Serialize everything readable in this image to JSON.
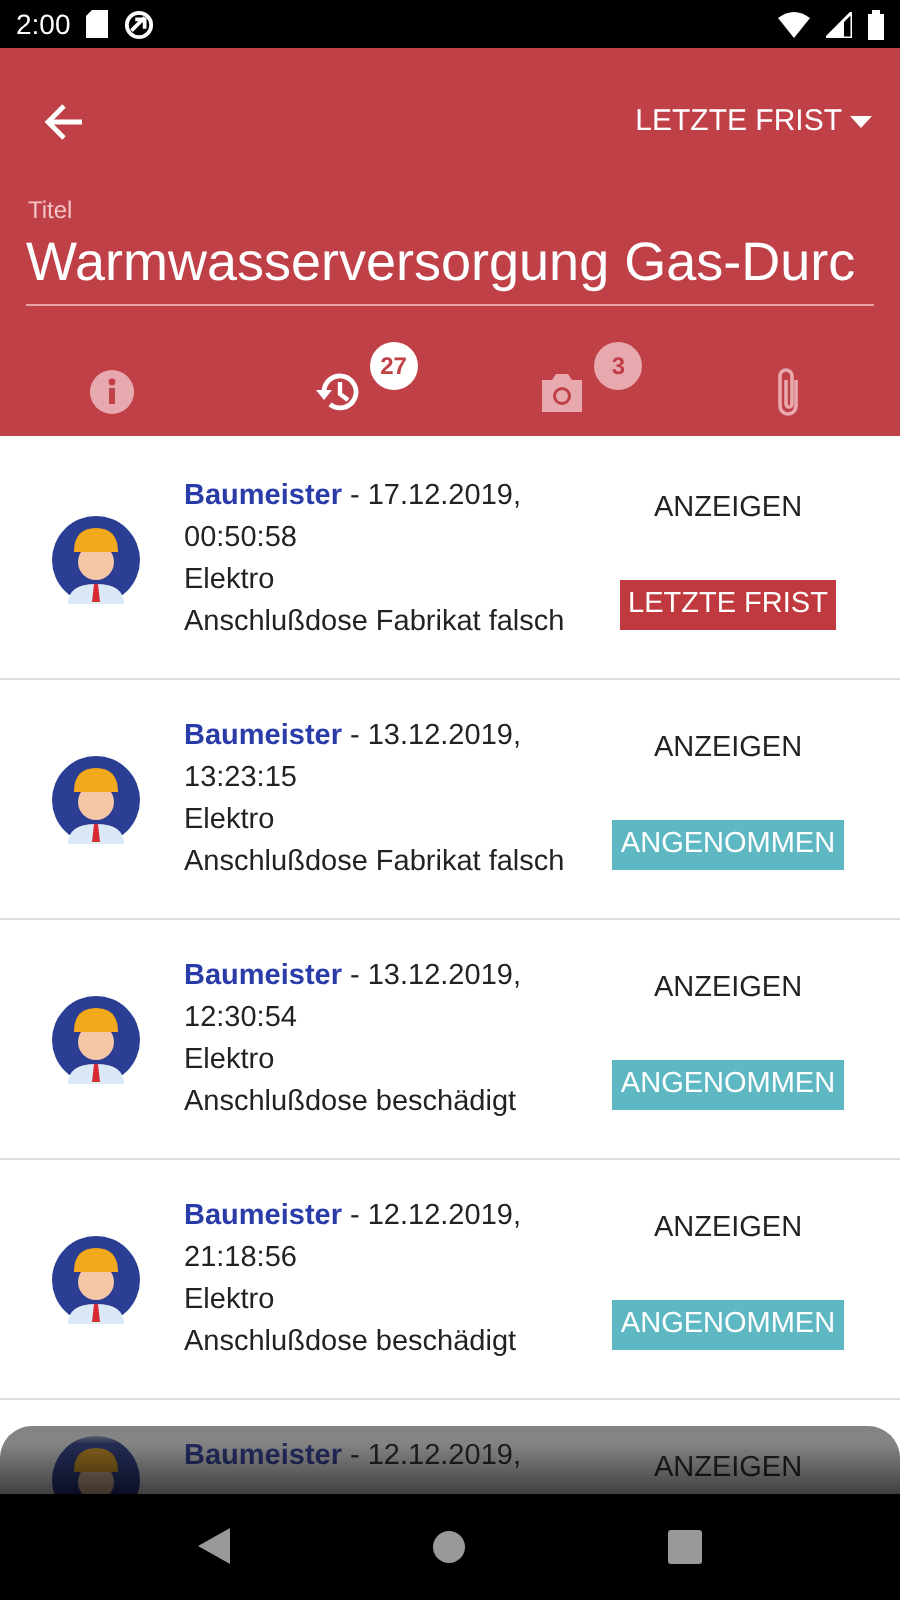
{
  "status_bar": {
    "time": "2:00"
  },
  "header": {
    "filter": "LETZTE FRIST",
    "title_label": "Titel",
    "title_value": "Warmwasserversorgung Gas-Durc"
  },
  "tabs": [
    {
      "kind": "info",
      "selected": false
    },
    {
      "kind": "history",
      "selected": true,
      "badge": "27"
    },
    {
      "kind": "camera",
      "selected": false,
      "badge": "3"
    },
    {
      "kind": "attachment",
      "selected": false
    }
  ],
  "entries": [
    {
      "heading": "**Baumeister** - 17.12.2019, 00:50:58",
      "category": "Elektro",
      "description": "Anschlußdose Fabrikat falsch",
      "action": "ANZEIGEN",
      "status": {
        "kind": "deadline",
        "label": "LETZTE FRIST"
      }
    },
    {
      "heading": "**Baumeister** - 13.12.2019, 13:23:15",
      "category": "Elektro",
      "description": "Anschlußdose Fabrikat falsch",
      "action": "ANZEIGEN",
      "status": {
        "kind": "accepted",
        "label": "ANGENOMMEN"
      }
    },
    {
      "heading": "**Baumeister** - 13.12.2019, 12:30:54",
      "category": "Elektro",
      "description": "Anschlußdose beschädigt",
      "action": "ANZEIGEN",
      "status": {
        "kind": "accepted",
        "label": "ANGENOMMEN"
      }
    },
    {
      "heading": "**Baumeister** - 12.12.2019, 21:18:56",
      "category": "Elektro",
      "description": "Anschlußdose beschädigt",
      "action": "ANZEIGEN",
      "status": {
        "kind": "accepted",
        "label": "ANGENOMMEN"
      }
    },
    {
      "heading": "**Baumeister** - 12.12.2019,",
      "action": "ANZEIGEN"
    }
  ]
}
